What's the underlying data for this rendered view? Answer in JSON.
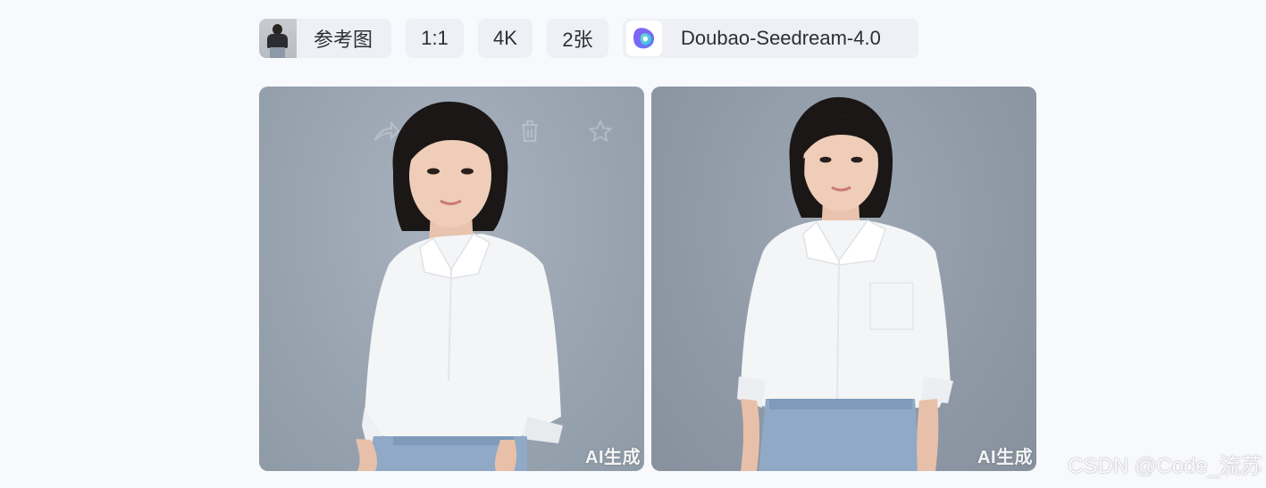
{
  "toolbar": {
    "reference_label": "参考图",
    "aspect_ratio": "1:1",
    "resolution": "4K",
    "image_count": "2张",
    "model_name": "Doubao-Seedream-4.0"
  },
  "results": [
    {
      "watermark": "AI生成"
    },
    {
      "watermark": "AI生成"
    }
  ],
  "overlay_actions": [
    "share-icon",
    "delete-icon",
    "favorite-icon"
  ],
  "page_watermark": "CSDN @Code_流苏",
  "colors": {
    "chip_bg": "#eef0f6",
    "page_bg": "#f8f9fc",
    "logo_purple": "#7b5cf5",
    "logo_teal": "#5fd3c0"
  }
}
